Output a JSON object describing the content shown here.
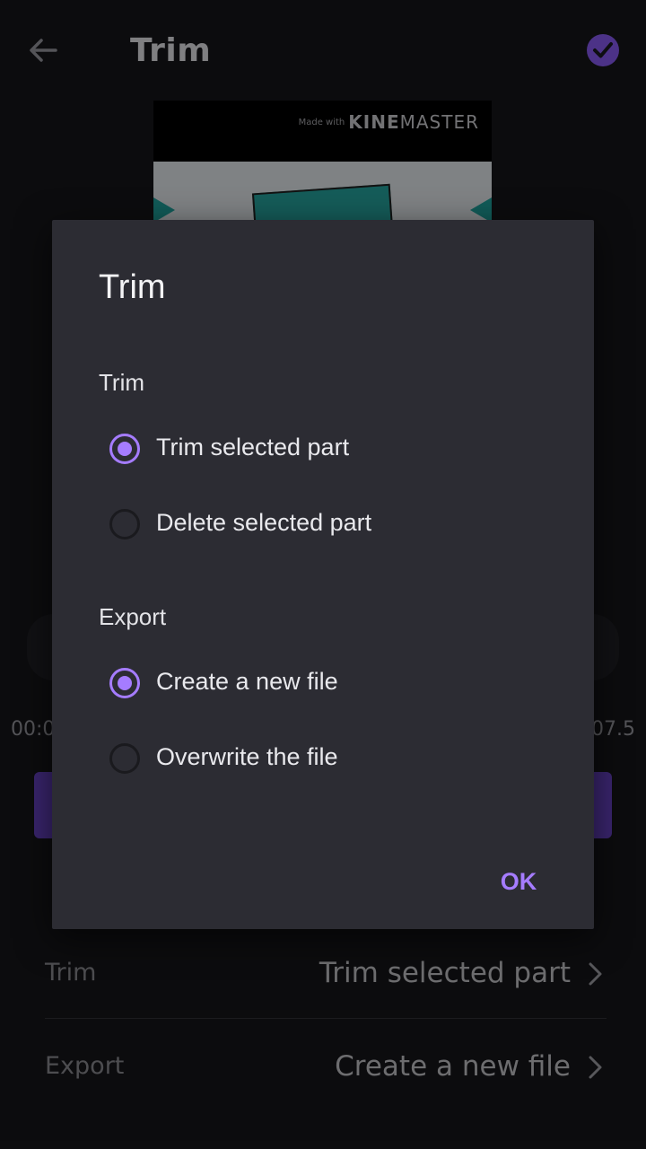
{
  "header": {
    "title": "Trim"
  },
  "preview": {
    "watermark_small": "Made with",
    "watermark_kine": "KINE",
    "watermark_master": "MASTER"
  },
  "timeline": {
    "start_time": "00:0",
    "end_time": "07.5"
  },
  "settings": {
    "rows": [
      {
        "label": "Trim",
        "value": "Trim selected part"
      },
      {
        "label": "Export",
        "value": "Create a new file"
      }
    ]
  },
  "dialog": {
    "title": "Trim",
    "sections": [
      {
        "label": "Trim",
        "options": [
          {
            "label": "Trim selected part",
            "checked": true
          },
          {
            "label": "Delete selected part",
            "checked": false
          }
        ]
      },
      {
        "label": "Export",
        "options": [
          {
            "label": "Create a new file",
            "checked": true
          },
          {
            "label": "Overwrite the file",
            "checked": false
          }
        ]
      }
    ],
    "ok_label": "OK"
  },
  "colors": {
    "accent": "#a57cff",
    "dialog_bg": "#2c2c33",
    "background": "#17171b"
  }
}
